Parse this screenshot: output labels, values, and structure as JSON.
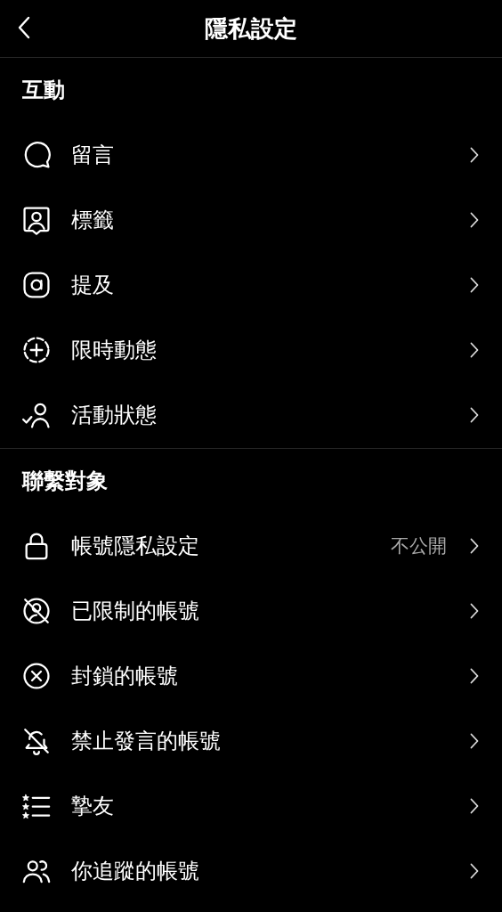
{
  "header": {
    "title": "隱私設定"
  },
  "sections": [
    {
      "title": "互動",
      "items": [
        {
          "kind": "comment",
          "label": "留言"
        },
        {
          "kind": "tag",
          "label": "標籤"
        },
        {
          "kind": "mention",
          "label": "提及"
        },
        {
          "kind": "story",
          "label": "限時動態"
        },
        {
          "kind": "activity",
          "label": "活動狀態"
        }
      ]
    },
    {
      "title": "聯繫對象",
      "items": [
        {
          "kind": "lock",
          "label": "帳號隱私設定",
          "value": "不公開"
        },
        {
          "kind": "restricted",
          "label": "已限制的帳號"
        },
        {
          "kind": "blocked",
          "label": "封鎖的帳號"
        },
        {
          "kind": "muted",
          "label": "禁止發言的帳號"
        },
        {
          "kind": "close-friends",
          "label": "摯友"
        },
        {
          "kind": "following",
          "label": "你追蹤的帳號"
        }
      ]
    }
  ]
}
